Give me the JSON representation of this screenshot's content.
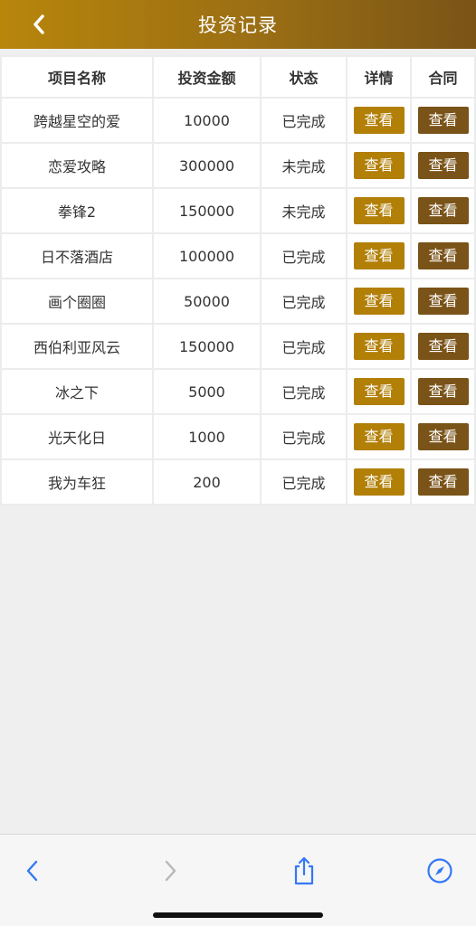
{
  "header": {
    "title": "投资记录",
    "back_icon": "chevron-left-icon"
  },
  "table": {
    "columns": [
      "项目名称",
      "投资金额",
      "状态",
      "详情",
      "合同"
    ],
    "rows": [
      {
        "name": "跨越星空的爱",
        "amount": "10000",
        "status": "已完成",
        "detail": "查看",
        "contract": "查看"
      },
      {
        "name": "恋爱攻略",
        "amount": "300000",
        "status": "未完成",
        "detail": "查看",
        "contract": "查看"
      },
      {
        "name": "拳锋2",
        "amount": "150000",
        "status": "未完成",
        "detail": "查看",
        "contract": "查看"
      },
      {
        "name": "日不落酒店",
        "amount": "100000",
        "status": "已完成",
        "detail": "查看",
        "contract": "查看"
      },
      {
        "name": "画个圈圈",
        "amount": "50000",
        "status": "已完成",
        "detail": "查看",
        "contract": "查看"
      },
      {
        "name": "西伯利亚风云",
        "amount": "150000",
        "status": "已完成",
        "detail": "查看",
        "contract": "查看"
      },
      {
        "name": "冰之下",
        "amount": "5000",
        "status": "已完成",
        "detail": "查看",
        "contract": "查看"
      },
      {
        "name": "光天化日",
        "amount": "1000",
        "status": "已完成",
        "detail": "查看",
        "contract": "查看"
      },
      {
        "name": "我为车狂",
        "amount": "200",
        "status": "已完成",
        "detail": "查看",
        "contract": "查看"
      }
    ]
  },
  "colors": {
    "header_gradient_start": "#b8860b",
    "header_gradient_end": "#7a5416",
    "detail_button": "#b27f07",
    "contract_button": "#7a5318",
    "browser_icon": "#3478f6"
  },
  "browser_toolbar": {
    "icons": [
      "back-arrow-icon",
      "forward-arrow-icon",
      "share-icon",
      "compass-icon"
    ]
  }
}
